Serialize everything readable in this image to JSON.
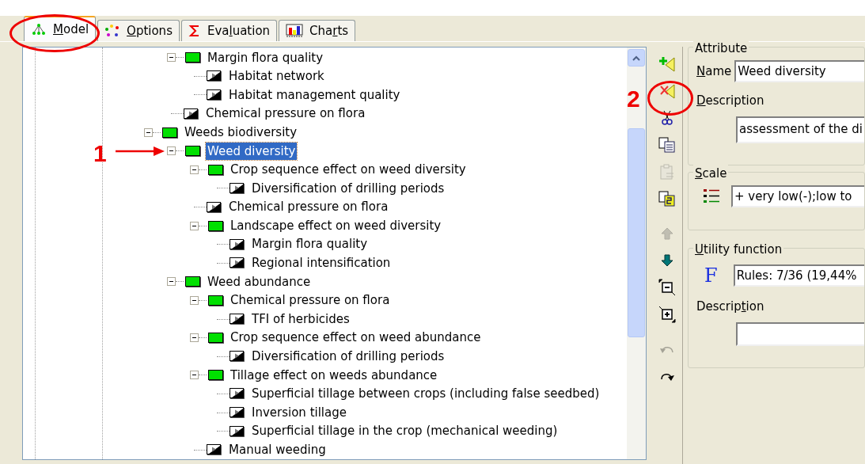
{
  "tabs": [
    {
      "label": "Model",
      "kind": "model",
      "selected": true
    },
    {
      "label": "Options",
      "kind": "options",
      "selected": false
    },
    {
      "label": "Evaluation",
      "kind": "evaluation",
      "selected": false
    },
    {
      "label": "Charts",
      "kind": "charts",
      "selected": false
    }
  ],
  "tree": [
    {
      "children": [
        {
          "label": "Margin flora quality",
          "kind": "aggregate",
          "expanded": true,
          "selected": false,
          "children": [
            {
              "label": "Habitat network",
              "kind": "basic",
              "selected": false
            },
            {
              "label": "Habitat management quality",
              "kind": "basic",
              "selected": false
            }
          ]
        },
        {
          "label": "Chemical pressure on flora",
          "kind": "basic",
          "selected": false
        }
      ]
    },
    {
      "label": "Weeds biodiversity",
      "kind": "aggregate",
      "expanded": true,
      "selected": false,
      "children": [
        {
          "label": "Weed diversity",
          "kind": "aggregate",
          "expanded": true,
          "selected": true,
          "children": [
            {
              "label": "Crop sequence effect on weed diversity",
              "kind": "aggregate",
              "expanded": true,
              "selected": false,
              "children": [
                {
                  "label": "Diversification of drilling periods",
                  "kind": "basic",
                  "selected": false
                }
              ]
            },
            {
              "label": "Chemical pressure on flora",
              "kind": "basic",
              "selected": false
            },
            {
              "label": "Landscape effect on weed diversity",
              "kind": "aggregate",
              "expanded": true,
              "selected": false,
              "children": [
                {
                  "label": "Margin flora quality",
                  "kind": "basic",
                  "selected": false
                },
                {
                  "label": "Regional intensification",
                  "kind": "basic",
                  "selected": false
                }
              ]
            }
          ]
        },
        {
          "label": "Weed abundance",
          "kind": "aggregate",
          "expanded": true,
          "selected": false,
          "children": [
            {
              "label": "Chemical pressure on flora",
              "kind": "aggregate",
              "expanded": true,
              "selected": false,
              "children": [
                {
                  "label": "TFI of herbicides",
                  "kind": "basic",
                  "selected": false
                }
              ]
            },
            {
              "label": "Crop sequence effect on weed abundance",
              "kind": "aggregate",
              "expanded": true,
              "selected": false,
              "children": [
                {
                  "label": "Diversification of drilling periods",
                  "kind": "basic",
                  "selected": false
                }
              ]
            },
            {
              "label": "Tillage effect on weeds abundance",
              "kind": "aggregate",
              "expanded": true,
              "selected": false,
              "children": [
                {
                  "label": "Superficial tillage between crops (including false seedbed)",
                  "kind": "basic",
                  "selected": false
                },
                {
                  "label": "Inversion tillage",
                  "kind": "basic",
                  "selected": false
                },
                {
                  "label": "Superficial tillage in the crop (mechanical weeding)",
                  "kind": "basic",
                  "selected": false
                }
              ]
            },
            {
              "label": "Manual weeding",
              "kind": "basic",
              "selected": false
            }
          ]
        }
      ]
    }
  ],
  "toolbar": [
    {
      "kind": "add",
      "disabled": false
    },
    {
      "kind": "delete",
      "disabled": false
    },
    {
      "kind": "cut",
      "disabled": false
    },
    {
      "kind": "copy",
      "disabled": false
    },
    {
      "kind": "paste",
      "disabled": true
    },
    {
      "kind": "duplicate",
      "disabled": false
    },
    {
      "kind": "up",
      "disabled": true
    },
    {
      "kind": "down",
      "disabled": false
    },
    {
      "kind": "collapse",
      "disabled": false
    },
    {
      "kind": "expand",
      "disabled": false
    },
    {
      "kind": "undo",
      "disabled": true
    },
    {
      "kind": "redo",
      "disabled": false
    }
  ],
  "attribute": {
    "title": "Attribute",
    "name_label": "Name",
    "name": "Weed diversity",
    "description_label": "Description",
    "description": "assessment of the di"
  },
  "scale": {
    "title": "Scale",
    "value": "+ very low(-);low to"
  },
  "utility_function": {
    "title": "Utility function",
    "icon": "F",
    "value": "Rules: 7/36 (19,44%",
    "description_label": "Description"
  },
  "annotations": [
    {
      "label": "1"
    },
    {
      "label": "2"
    }
  ]
}
